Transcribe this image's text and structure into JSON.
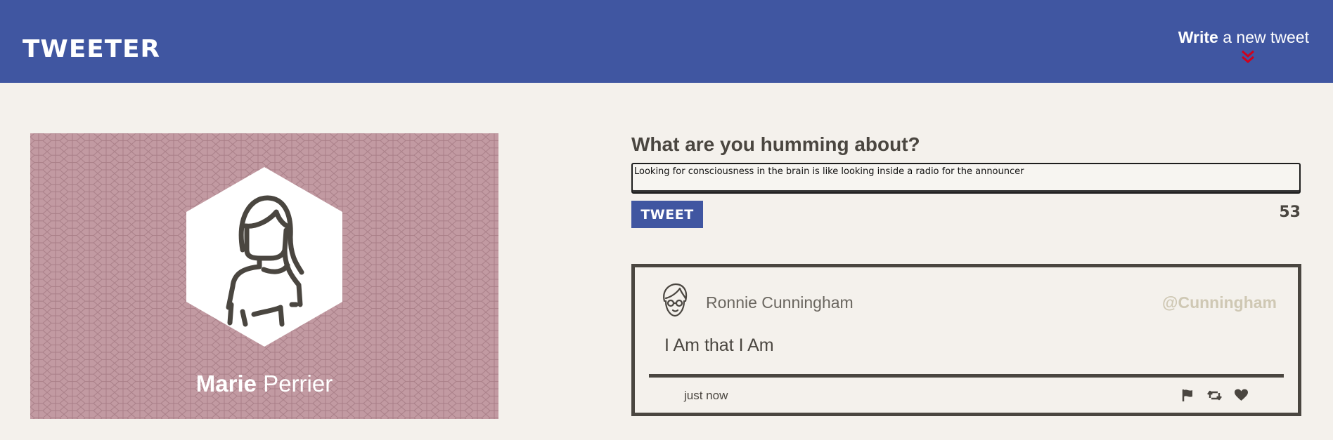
{
  "header": {
    "logo": "TWEETER",
    "write_bold": "Write",
    "write_rest": " a new tweet",
    "chevron_icon": "double-chevron-down-icon",
    "bg_color": "#4056a1",
    "chevron_color": "#d0021b"
  },
  "profile": {
    "first_name": "Marie",
    "last_name": " Perrier",
    "avatar_icon": "woman-avatar-icon",
    "bg_color": "#c29aa2"
  },
  "compose": {
    "title": "What are you humming about?",
    "value": "Looking for consciousness in the brain is like looking inside a radio for the announcer",
    "button_label": "TWEET",
    "counter": "53"
  },
  "tweets": [
    {
      "avatar_icon": "man-with-glasses-avatar-icon",
      "author": "Ronnie Cunningham",
      "handle": "@Cunningham",
      "text": "I Am that I Am",
      "time": "just now",
      "actions": [
        "flag-icon",
        "retweet-icon",
        "heart-icon"
      ]
    }
  ]
}
